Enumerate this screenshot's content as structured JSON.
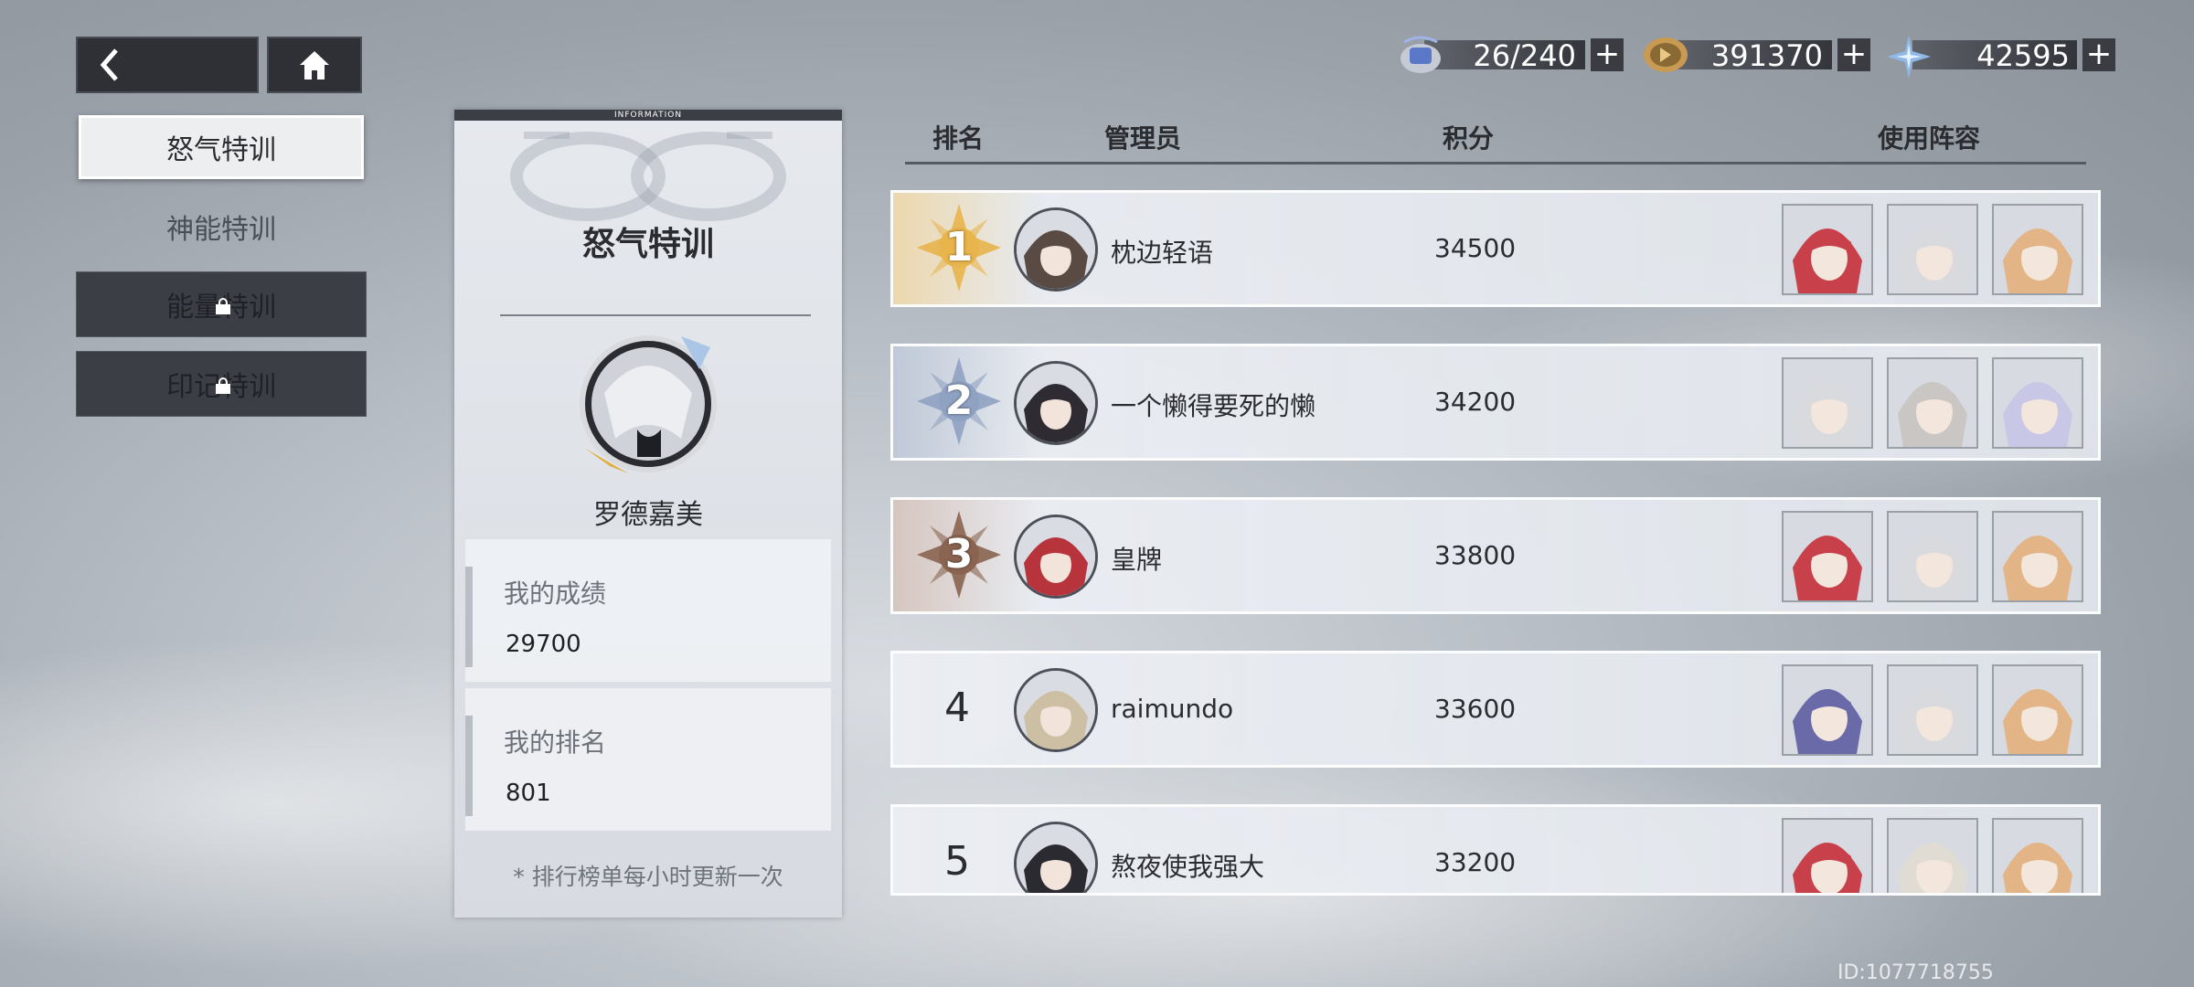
{
  "nav": {
    "back": "back",
    "home": "home"
  },
  "menu": [
    {
      "label": "怒气特训",
      "state": "active"
    },
    {
      "label": "神能特训",
      "state": "available"
    },
    {
      "label": "能量特训",
      "state": "locked"
    },
    {
      "label": "印记特训",
      "state": "locked"
    }
  ],
  "currencies": [
    {
      "icon": "stamina-icon",
      "value": "26/240"
    },
    {
      "icon": "coin-icon",
      "value": "391370"
    },
    {
      "icon": "crystal-icon",
      "value": "42595"
    }
  ],
  "info": {
    "header": "INFORMATION",
    "title": "怒气特训",
    "player_name": "罗德嘉美",
    "my_score_label": "我的成绩",
    "my_score": "29700",
    "my_rank_label": "我的排名",
    "my_rank": "801",
    "footnote": "* 排行榜单每小时更新一次"
  },
  "columns": {
    "rank": "排名",
    "manager": "管理员",
    "score": "积分",
    "lineup": "使用阵容"
  },
  "leaderboard": [
    {
      "rank": "1",
      "name": "枕边轻语",
      "score": "34500",
      "medal": "gold",
      "avatar_color": "#5a4a44",
      "lineup": [
        "#c8404a",
        "#d8dade",
        "#e2b486"
      ]
    },
    {
      "rank": "2",
      "name": "一个懒得要死的懒",
      "score": "34200",
      "medal": "silver",
      "avatar_color": "#2e2c32",
      "lineup": [
        "#d8dade",
        "#c9c6c4",
        "#c8c8e6"
      ]
    },
    {
      "rank": "3",
      "name": "皇牌",
      "score": "33800",
      "medal": "bronze",
      "avatar_color": "#b8343c",
      "lineup": [
        "#c8404a",
        "#d8dade",
        "#e2b486"
      ]
    },
    {
      "rank": "4",
      "name": "raimundo",
      "score": "33600",
      "medal": "",
      "avatar_color": "#cdbfa4",
      "lineup": [
        "#6a6aa8",
        "#d8dade",
        "#e2b486"
      ]
    },
    {
      "rank": "5",
      "name": "熬夜使我强大",
      "score": "33200",
      "medal": "",
      "avatar_color": "#2a2a30",
      "lineup": [
        "#c8404a",
        "#e0dcd4",
        "#e2b486"
      ]
    }
  ],
  "uid": "ID:1077718755",
  "colors": {
    "gold": "#e8b44c",
    "silver": "#8fa2c2",
    "bronze": "#8a6450"
  }
}
